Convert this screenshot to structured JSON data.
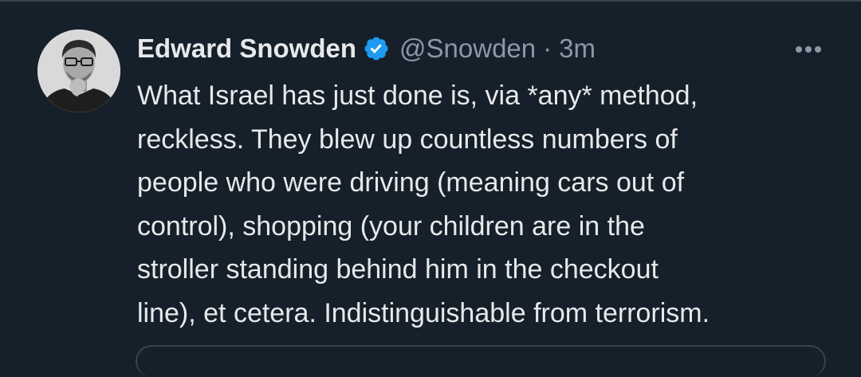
{
  "tweet": {
    "author": {
      "display_name": "Edward Snowden",
      "handle": "@Snowden",
      "verified_icon": "verified-badge-icon",
      "avatar_icon": "profile-photo"
    },
    "separator": "·",
    "time": "3m",
    "more_icon": "more-options-icon",
    "text_lines": [
      "What Israel has just done is, via *any* method,",
      "reckless. They blew up countless numbers of",
      "people who were driving (meaning cars out of",
      "control), shopping (your children are in the",
      "stroller standing behind him in the checkout",
      "line), et cetera. Indistinguishable from terrorism."
    ]
  },
  "colors": {
    "background": "#15202b",
    "text_primary": "#e7e9ea",
    "text_secondary": "#8b98a5",
    "verified_blue": "#1d9bf0",
    "border": "#38444d"
  }
}
